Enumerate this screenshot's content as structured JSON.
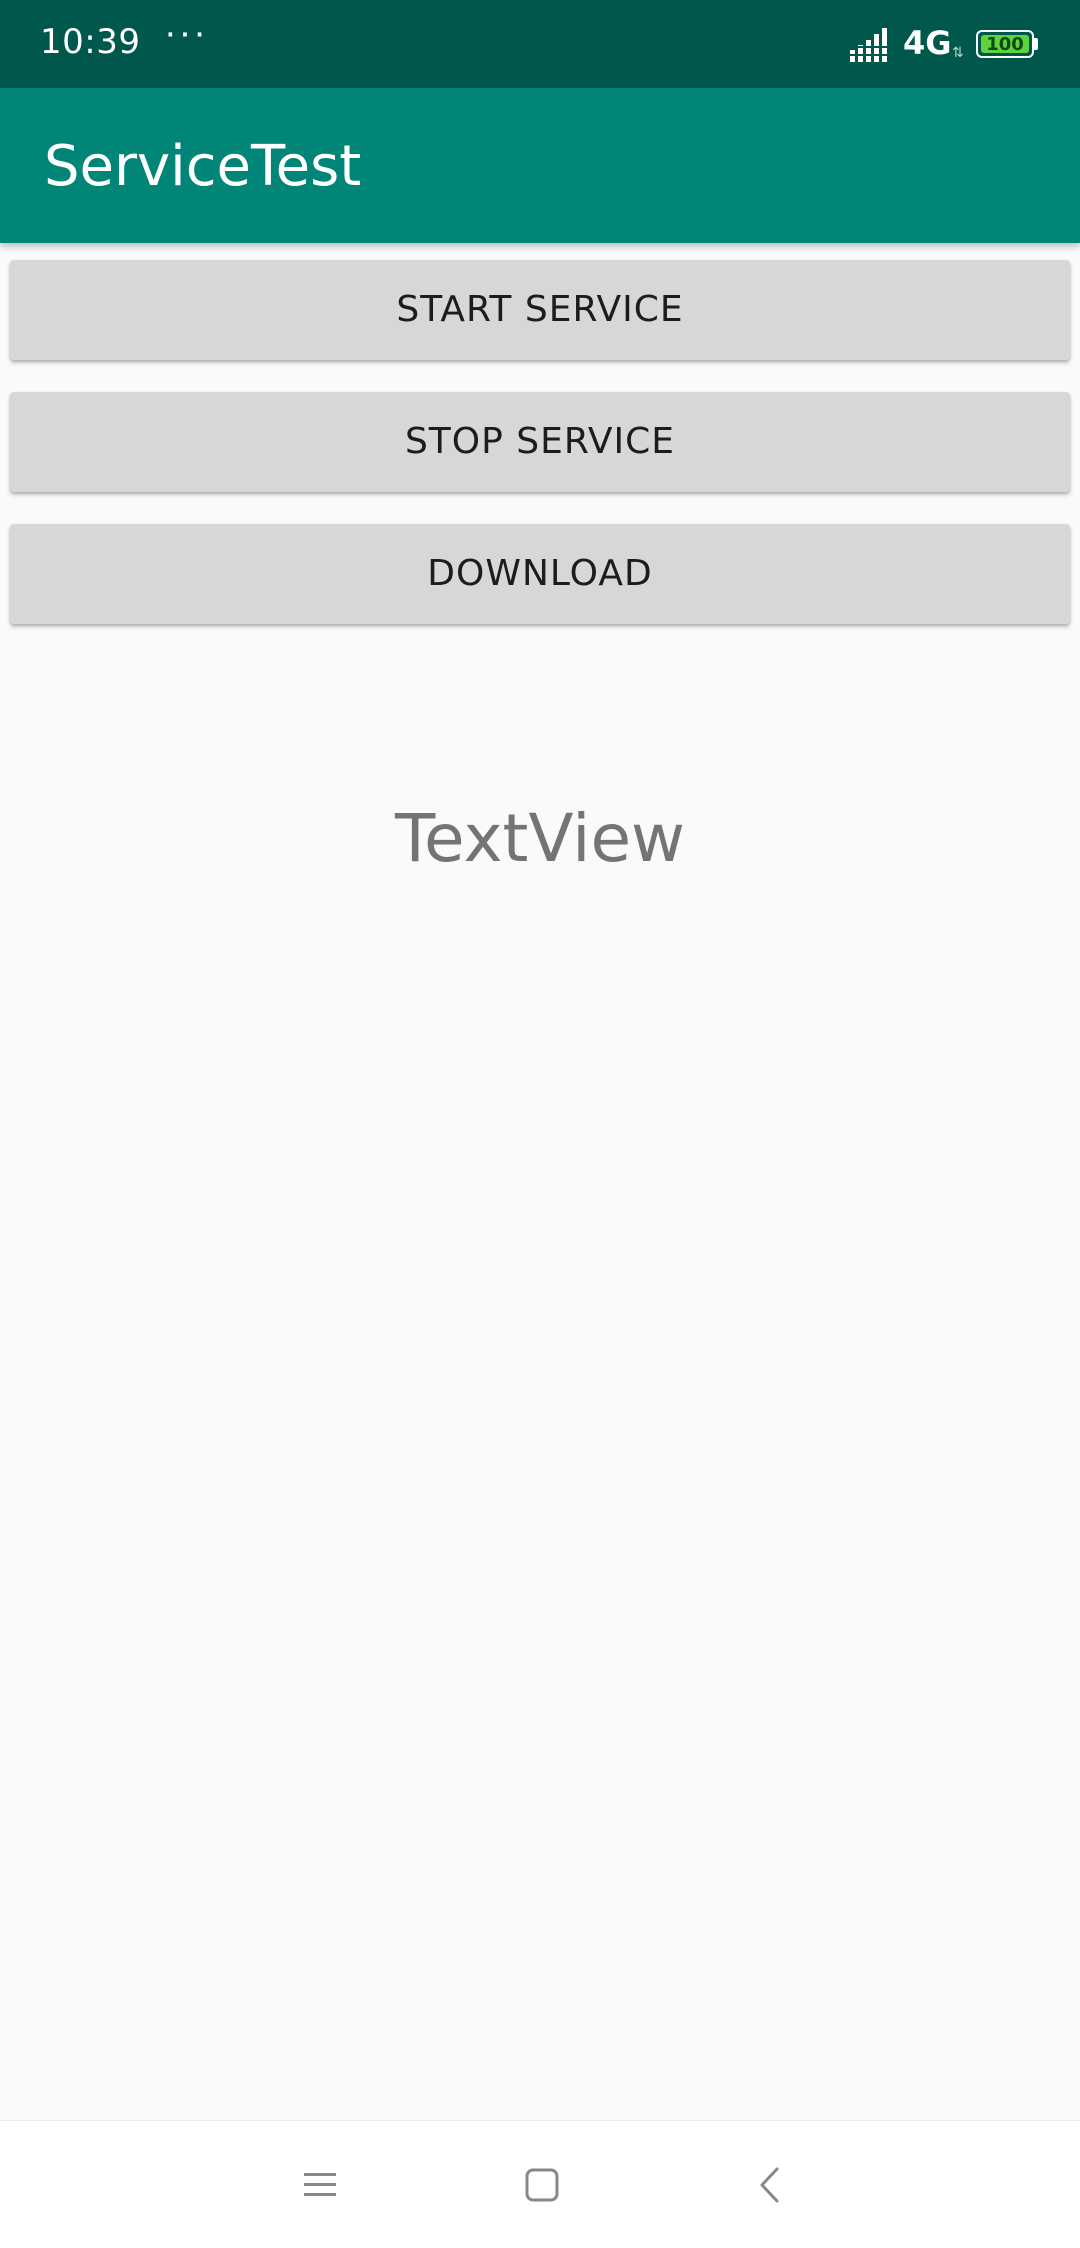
{
  "status_bar": {
    "time": "10:39",
    "more": "···",
    "network": "4G",
    "battery": "100",
    "background_color": "#00574b"
  },
  "app_bar": {
    "title": "ServiceTest",
    "background_color": "#008577"
  },
  "buttons": {
    "start_service": "START SERVICE",
    "stop_service": "STOP SERVICE",
    "download": "DOWNLOAD"
  },
  "text_view": {
    "text": "TextView"
  },
  "nav_bar": {
    "icons": [
      "menu-icon",
      "home-icon",
      "back-icon"
    ]
  }
}
